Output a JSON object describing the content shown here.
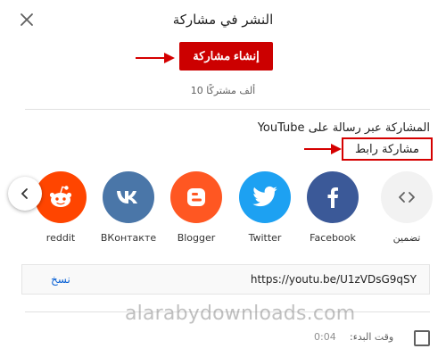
{
  "dialog": {
    "title": "النشر في مشاركة",
    "create_post_label": "إنشاء مشاركة",
    "subscriber_count": "10 ألف مشتركًا"
  },
  "share_section": {
    "heading": "المشاركة عبر رسالة على YouTube",
    "share_link_label": "مشاركة رابط"
  },
  "share_targets": [
    {
      "label": "تضمين",
      "icon": "embed-icon",
      "color": "#f2f2f2"
    },
    {
      "label": "Facebook",
      "icon": "facebook-icon",
      "color": "#3b5998"
    },
    {
      "label": "Twitter",
      "icon": "twitter-icon",
      "color": "#1da1f2"
    },
    {
      "label": "Blogger",
      "icon": "blogger-icon",
      "color": "#ff5722"
    },
    {
      "label": "ВКонтакте",
      "icon": "vk-icon",
      "color": "#4a76a8"
    },
    {
      "label": "reddit",
      "icon": "reddit-icon",
      "color": "#ff4500"
    }
  ],
  "link": {
    "url": "https://youtu.be/U1zVDsG9qSY",
    "copy_label": "نسخ"
  },
  "start_at": {
    "label": "وقت البدء:",
    "time": "0:04",
    "checked": false
  },
  "watermark": "alarabydownloads.com",
  "colors": {
    "brand_red": "#cc0000",
    "annotation_red": "#d50000",
    "link_blue": "#065fd4"
  }
}
